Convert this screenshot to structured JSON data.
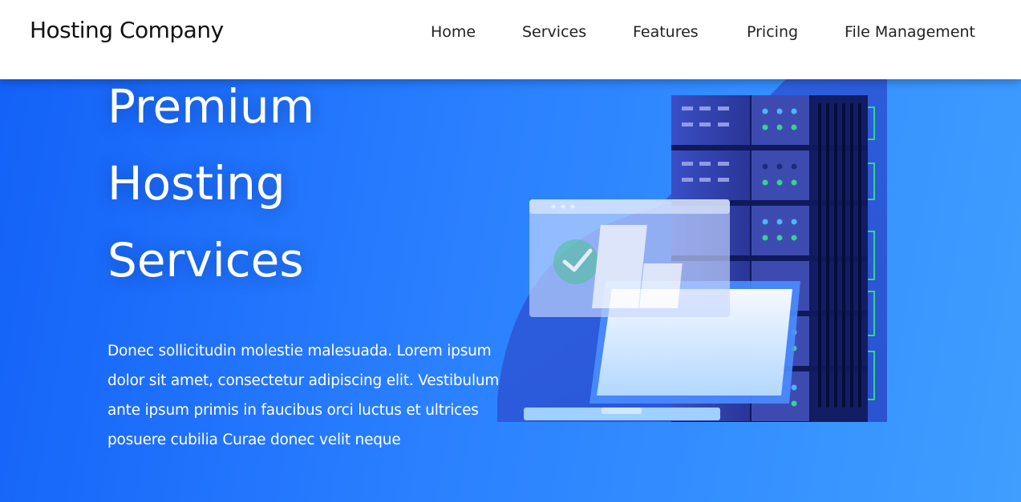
{
  "navbar": {
    "brand": "Hosting Company",
    "links": [
      {
        "label": "Home"
      },
      {
        "label": "Services"
      },
      {
        "label": "Features"
      },
      {
        "label": "Pricing"
      },
      {
        "label": "File Management"
      }
    ]
  },
  "hero": {
    "title_lines": [
      "Premium",
      "Hosting",
      "Services"
    ],
    "body": "Donec sollicitudin molestie malesuada. Lorem ipsum dolor sit amet, consectetur adipiscing elit. Vestibulum ante ipsum primis in faucibus orci luctus et ultrices posuere cubilia Curae donec velit neque",
    "illustration_icon": "server-rack-laptop-illustration"
  },
  "colors": {
    "hero_start": "#1462f8",
    "hero_end": "#3f9eff",
    "navbar_bg": "#ffffff",
    "text_dark": "#111111"
  }
}
